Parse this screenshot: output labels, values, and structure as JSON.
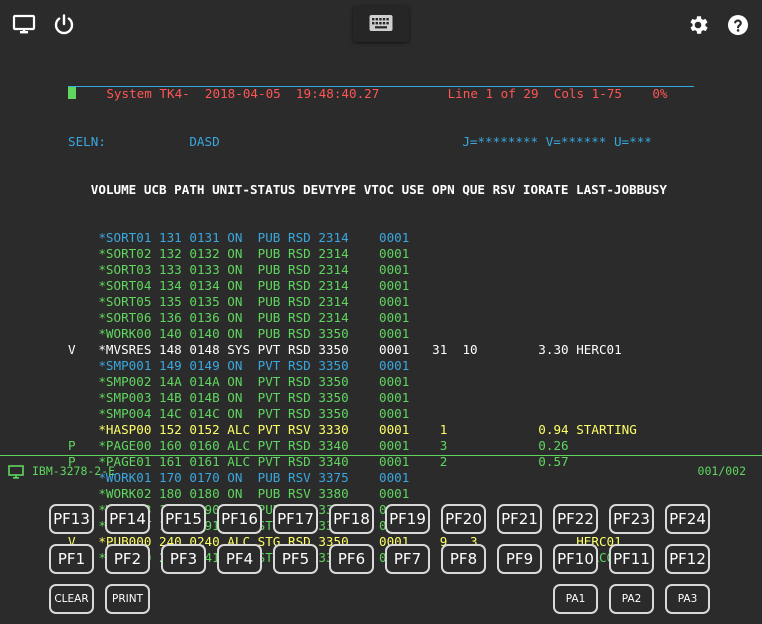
{
  "toolbar": {
    "left_icons": [
      "monitor-icon",
      "power-icon"
    ],
    "center_icon": "keyboard-icon",
    "right_icons": [
      "gear-icon",
      "help-icon"
    ]
  },
  "screen": {
    "header": {
      "system": "System TK4-",
      "date": "2018-04-05",
      "time": "19:48:40.27",
      "line_info": "Line 1 of 29",
      "cols_info": "Cols 1-75",
      "percent": "0%"
    },
    "seln_label": "SELN:",
    "seln_value": "DASD",
    "filters": "J=******** V=****** U=***",
    "columns": "VOLUME UCB PATH UNIT-STATUS DEVTYPE VTOC USE OPN QUE RSV IORATE LAST-JOBBUSY",
    "rows": [
      {
        "flag": "",
        "vol": "*SORT01",
        "ucb": "131",
        "path": "0131",
        "stat": "ON",
        "mnt": "PUB",
        "use": "RSD",
        "dev": "2314",
        "vtoc": "0001",
        "cnt": "",
        "opn": "",
        "rest": "",
        "c1": "cyan",
        "c2": "cyan"
      },
      {
        "flag": "",
        "vol": "*SORT02",
        "ucb": "132",
        "path": "0132",
        "stat": "ON",
        "mnt": "PUB",
        "use": "RSD",
        "dev": "2314",
        "vtoc": "0001",
        "cnt": "",
        "opn": "",
        "rest": "",
        "c1": "green",
        "c2": "green"
      },
      {
        "flag": "",
        "vol": "*SORT03",
        "ucb": "133",
        "path": "0133",
        "stat": "ON",
        "mnt": "PUB",
        "use": "RSD",
        "dev": "2314",
        "vtoc": "0001",
        "cnt": "",
        "opn": "",
        "rest": "",
        "c1": "green",
        "c2": "green"
      },
      {
        "flag": "",
        "vol": "*SORT04",
        "ucb": "134",
        "path": "0134",
        "stat": "ON",
        "mnt": "PUB",
        "use": "RSD",
        "dev": "2314",
        "vtoc": "0001",
        "cnt": "",
        "opn": "",
        "rest": "",
        "c1": "green",
        "c2": "green"
      },
      {
        "flag": "",
        "vol": "*SORT05",
        "ucb": "135",
        "path": "0135",
        "stat": "ON",
        "mnt": "PUB",
        "use": "RSD",
        "dev": "2314",
        "vtoc": "0001",
        "cnt": "",
        "opn": "",
        "rest": "",
        "c1": "green",
        "c2": "green"
      },
      {
        "flag": "",
        "vol": "*SORT06",
        "ucb": "136",
        "path": "0136",
        "stat": "ON",
        "mnt": "PUB",
        "use": "RSD",
        "dev": "2314",
        "vtoc": "0001",
        "cnt": "",
        "opn": "",
        "rest": "",
        "c1": "green",
        "c2": "green"
      },
      {
        "flag": "",
        "vol": "*WORK00",
        "ucb": "140",
        "path": "0140",
        "stat": "ON",
        "mnt": "PUB",
        "use": "RSD",
        "dev": "3350",
        "vtoc": "0001",
        "cnt": "",
        "opn": "",
        "rest": "",
        "c1": "green",
        "c2": "green"
      },
      {
        "flag": "V",
        "vol": "*MVSRES",
        "ucb": "148",
        "path": "0148",
        "stat": "SYS",
        "mnt": "PVT",
        "use": "RSD",
        "dev": "3350",
        "vtoc": "0001",
        "cnt": "31",
        "opn": "10",
        "rest": "        3.30 HERC01",
        "c1": "white",
        "c2": "white"
      },
      {
        "flag": "",
        "vol": "*SMP001",
        "ucb": "149",
        "path": "0149",
        "stat": "ON",
        "mnt": "PVT",
        "use": "RSD",
        "dev": "3350",
        "vtoc": "0001",
        "cnt": "",
        "opn": "",
        "rest": "",
        "c1": "cyan",
        "c2": "cyan"
      },
      {
        "flag": "",
        "vol": "*SMP002",
        "ucb": "14A",
        "path": "014A",
        "stat": "ON",
        "mnt": "PVT",
        "use": "RSD",
        "dev": "3350",
        "vtoc": "0001",
        "cnt": "",
        "opn": "",
        "rest": "",
        "c1": "green",
        "c2": "green"
      },
      {
        "flag": "",
        "vol": "*SMP003",
        "ucb": "14B",
        "path": "014B",
        "stat": "ON",
        "mnt": "PVT",
        "use": "RSD",
        "dev": "3350",
        "vtoc": "0001",
        "cnt": "",
        "opn": "",
        "rest": "",
        "c1": "green",
        "c2": "green"
      },
      {
        "flag": "",
        "vol": "*SMP004",
        "ucb": "14C",
        "path": "014C",
        "stat": "ON",
        "mnt": "PVT",
        "use": "RSD",
        "dev": "3350",
        "vtoc": "0001",
        "cnt": "",
        "opn": "",
        "rest": "",
        "c1": "green",
        "c2": "green"
      },
      {
        "flag": "",
        "vol": "*HASP00",
        "ucb": "152",
        "path": "0152",
        "stat": "ALC",
        "mnt": "PVT",
        "use": "RSV",
        "dev": "3330",
        "vtoc": "0001",
        "cnt": "1",
        "opn": "",
        "rest": "        0.94 STARTING",
        "c1": "yellow",
        "c2": "yellow"
      },
      {
        "flag": "P",
        "vol": "*PAGE00",
        "ucb": "160",
        "path": "0160",
        "stat": "ALC",
        "mnt": "PVT",
        "use": "RSD",
        "dev": "3340",
        "vtoc": "0001",
        "cnt": "3",
        "opn": "",
        "rest": "        0.26",
        "c1": "green",
        "c2": "green"
      },
      {
        "flag": "P",
        "vol": "*PAGE01",
        "ucb": "161",
        "path": "0161",
        "stat": "ALC",
        "mnt": "PVT",
        "use": "RSD",
        "dev": "3340",
        "vtoc": "0001",
        "cnt": "2",
        "opn": "",
        "rest": "        0.57",
        "c1": "green",
        "c2": "green"
      },
      {
        "flag": "",
        "vol": "*WORK01",
        "ucb": "170",
        "path": "0170",
        "stat": "ON",
        "mnt": "PUB",
        "use": "RSV",
        "dev": "3375",
        "vtoc": "0001",
        "cnt": "",
        "opn": "",
        "rest": "",
        "c1": "cyan",
        "c2": "cyan"
      },
      {
        "flag": "",
        "vol": "*WORK02",
        "ucb": "180",
        "path": "0180",
        "stat": "ON",
        "mnt": "PUB",
        "use": "RSV",
        "dev": "3380",
        "vtoc": "0001",
        "cnt": "",
        "opn": "",
        "rest": "",
        "c1": "green",
        "c2": "green"
      },
      {
        "flag": "",
        "vol": "*WORK03",
        "ucb": "190",
        "path": "0190",
        "stat": "ON",
        "mnt": "PUB",
        "use": "RSV",
        "dev": "3390",
        "vtoc": "0001",
        "cnt": "",
        "opn": "",
        "rest": "",
        "c1": "green",
        "c2": "green"
      },
      {
        "flag": "",
        "vol": "*MVSCAT",
        "ucb": "191",
        "path": "0191",
        "stat": "ON",
        "mnt": "STG",
        "use": "RSV",
        "dev": "3390",
        "vtoc": "0001",
        "cnt": "",
        "opn": "",
        "rest": "",
        "c1": "green",
        "c2": "green"
      },
      {
        "flag": "V",
        "vol": "*PUB000",
        "ucb": "240",
        "path": "0240",
        "stat": "ALC",
        "mnt": "STG",
        "use": "RSD",
        "dev": "3350",
        "vtoc": "0001",
        "cnt": "9",
        "opn": "3",
        "rest": "             HERC01",
        "c1": "yellow",
        "c2": "yellow"
      },
      {
        "flag": "",
        "vol": "*PUB010",
        "ucb": "241",
        "path": "0241",
        "stat": "ALC",
        "mnt": "STG",
        "use": "RSD",
        "dev": "3350",
        "vtoc": "0001",
        "cnt": "1",
        "opn": "",
        "rest": "             HERC01",
        "c1": "green",
        "c2": "green"
      }
    ]
  },
  "status": {
    "terminal_type": "IBM-3278-2-E",
    "cursor_pos": "001/002"
  },
  "keys": {
    "row1": [
      "PF13",
      "PF14",
      "PF15",
      "PF16",
      "PF17",
      "PF18",
      "PF19",
      "PF20",
      "PF21",
      "PF22",
      "PF23",
      "PF24"
    ],
    "row2": [
      "PF1",
      "PF2",
      "PF3",
      "PF4",
      "PF5",
      "PF6",
      "PF7",
      "PF8",
      "PF9",
      "PF10",
      "PF11",
      "PF12"
    ],
    "row3_left": [
      "CLEAR",
      "PRINT"
    ],
    "row3_right": [
      "PA1",
      "PA2",
      "PA3"
    ]
  }
}
